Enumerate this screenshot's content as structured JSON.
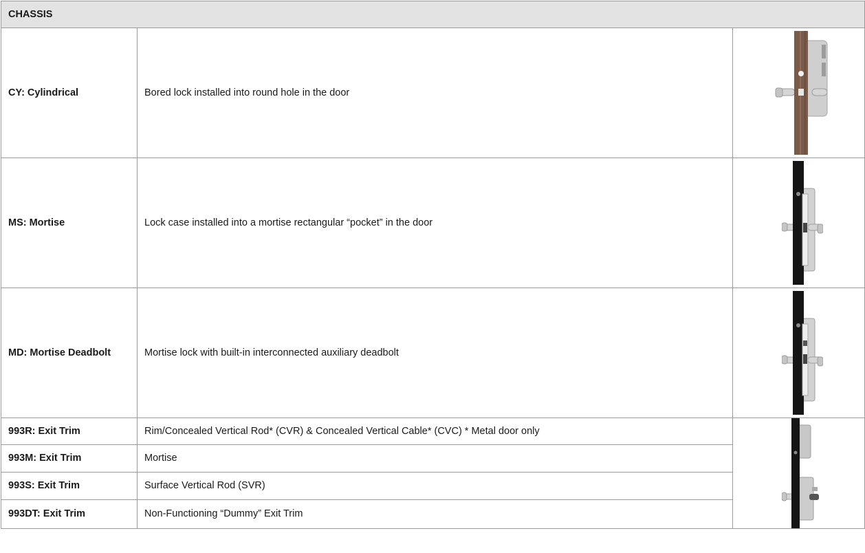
{
  "section_title": "CHASSIS",
  "rows": [
    {
      "code": "CY: Cylindrical",
      "description": "Bored lock installed into round hole in the door",
      "image": "cylindrical-lock-photo"
    },
    {
      "code": "MS: Mortise",
      "description": "Lock case installed into a mortise rectangular “pocket” in the door",
      "image": "mortise-lock-photo"
    },
    {
      "code": "MD: Mortise Deadbolt",
      "description": "Mortise lock with built-in interconnected auxiliary deadbolt",
      "image": "mortise-deadbolt-lock-photo"
    },
    {
      "code": "993R: Exit Trim",
      "description": "Rim/Concealed Vertical Rod* (CVR) & Concealed Vertical Cable* (CVC) * Metal door only"
    },
    {
      "code": "993M: Exit Trim",
      "description": "Mortise"
    },
    {
      "code": "993S: Exit Trim",
      "description": "Surface Vertical Rod (SVR)"
    },
    {
      "code": "993DT: Exit Trim",
      "description": "Non-Functioning “Dummy” Exit Trim",
      "image": "exit-trim-lock-photo"
    }
  ],
  "colors": {
    "header_bg": "#e3e3e3",
    "border": "#9a9a9a",
    "wood_door": "#7a5a48",
    "black_door": "#151515",
    "metal": "#c9c9c9"
  }
}
